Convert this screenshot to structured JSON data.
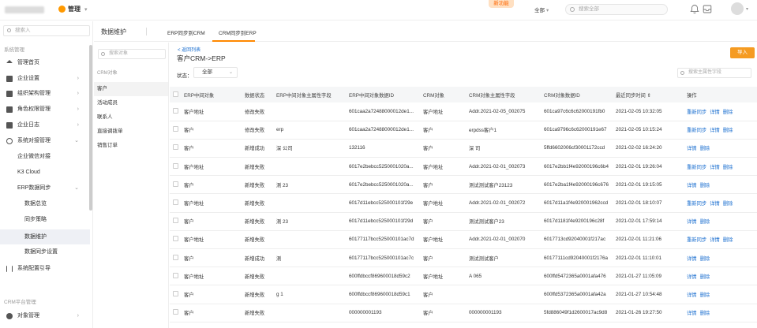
{
  "topbar": {
    "brand_label": "管理",
    "new_badge": "新功能",
    "scope_label": "全部",
    "search_placeholder": "搜索全部"
  },
  "sidebar": {
    "search_placeholder": "搜索入",
    "section1": "系统管理",
    "items": [
      {
        "label": "管理首页"
      },
      {
        "label": "企业设置"
      },
      {
        "label": "组织架构管理"
      },
      {
        "label": "角色权限管理"
      },
      {
        "label": "企业日志"
      },
      {
        "label": "系统对接管理"
      },
      {
        "label": "企业微信对接"
      },
      {
        "label": "K3 Cloud"
      },
      {
        "label": "ERP数据同步"
      },
      {
        "label": "数据总览"
      },
      {
        "label": "同步策略"
      },
      {
        "label": "数据维护"
      },
      {
        "label": "数据同步设置"
      },
      {
        "label": "系统配置引导"
      }
    ],
    "section2": "CRM平台管理",
    "bottom_item": "对象管理"
  },
  "tabs": {
    "title": "数据维护",
    "tab1": "ERP同步到CRM",
    "tab2": "CRM同步到ERP"
  },
  "objects": {
    "search_placeholder": "搜索对象",
    "section": "CRM对象",
    "items": [
      "客户",
      "活动成员",
      "联系人",
      "直接调拨单",
      "销售订单"
    ]
  },
  "content": {
    "back_link": "< 返回列表",
    "title": "客户CRM->ERP",
    "import_label": "导入",
    "status_label": "状态：",
    "status_value": "全部",
    "field_search_placeholder": "搜索主属性字段"
  },
  "table": {
    "headers": [
      "ERP中间对象",
      "数据状态",
      "ERP中间对象主属性字段",
      "ERP中间对象数据ID",
      "CRM对象",
      "CRM对象主属性字段",
      "CRM对象数据ID",
      "最近同步时间 ⇕",
      "操作"
    ],
    "rows": [
      {
        "erp_obj": "客户地址",
        "status": "修改失败",
        "erp_field": "",
        "erp_id": "601caa2a72488000012de1...",
        "crm_obj": "客户地址",
        "crm_field": "Addr.2021-02-05_002075",
        "crm_id": "601ca97c6c6c62000191fb0",
        "time": "2021-02-05 10:32:05",
        "ops": [
          "重新同步",
          "详情",
          "删除"
        ]
      },
      {
        "erp_obj": "客户",
        "status": "修改失败",
        "erp_field": "erp",
        "erp_id": "601caa2a72488000012de1...",
        "crm_obj": "客户",
        "crm_field": "erpdss客户1",
        "crm_id": "601ca9796c6c62000191e67",
        "time": "2021-02-05 10:15:24",
        "ops": [
          "重新同步",
          "详情",
          "删除"
        ]
      },
      {
        "erp_obj": "客户",
        "status": "新增成功",
        "erp_field": "深 公司",
        "erp_id": "132116",
        "crm_obj": "客户",
        "crm_field": "深 司",
        "crm_id": "5ffd6602006cf30001172ccd",
        "time": "2021-02-02 16:24:20",
        "ops": [
          "详情",
          "删除"
        ]
      },
      {
        "erp_obj": "客户地址",
        "status": "新增失败",
        "erp_field": "",
        "erp_id": "6017e2bebcc5250001020a...",
        "crm_obj": "客户地址",
        "crm_field": "Addr.2021-02-01_002073",
        "crm_id": "6017e2bb1f4e92000196c6b4",
        "time": "2021-02-01 19:26:04",
        "ops": [
          "重新同步",
          "详情",
          "删除"
        ]
      },
      {
        "erp_obj": "客户",
        "status": "新增失败",
        "erp_field": "测 23",
        "erp_id": "6017e2bebcc5250001020a...",
        "crm_obj": "客户",
        "crm_field": "测试测试客户23123",
        "crm_id": "6017e2ba1f4e92000196c676",
        "time": "2021-02-01 19:15:05",
        "ops": [
          "详情",
          "删除"
        ]
      },
      {
        "erp_obj": "客户地址",
        "status": "新增失败",
        "erp_field": "",
        "erp_id": "6017d11ebcc525000101f29e",
        "crm_obj": "客户地址",
        "crm_field": "Addr.2021-02-01_002072",
        "crm_id": "6017d11a1f4e920001962ccd",
        "time": "2021-02-01 18:10:07",
        "ops": [
          "重新同步",
          "详情",
          "删除"
        ]
      },
      {
        "erp_obj": "客户",
        "status": "新增失败",
        "erp_field": "测 23",
        "erp_id": "6017d11ebcc525000101f29d",
        "crm_obj": "客户",
        "crm_field": "测试测试客户23",
        "crm_id": "6017d1181f4e9200196c28f",
        "time": "2021-02-01 17:59:14",
        "ops": [
          "详情",
          "删除"
        ]
      },
      {
        "erp_obj": "客户地址",
        "status": "新增失败",
        "erp_field": "",
        "erp_id": "60177117bcc525000101ac7d",
        "crm_obj": "客户地址",
        "crm_field": "Addr.2021-02-01_002070",
        "crm_id": "6017713cd92040001f217ac",
        "time": "2021-02-01 11:21:06",
        "ops": [
          "重新同步",
          "详情",
          "删除"
        ]
      },
      {
        "erp_obj": "客户",
        "status": "新增成功",
        "erp_field": "测",
        "erp_id": "60177117bcc525000101ac7c",
        "crm_obj": "客户",
        "crm_field": "测试测试客户",
        "crm_id": "60177111cd92040001f2176a",
        "time": "2021-02-01 11:10:01",
        "ops": [
          "详情",
          "删除"
        ]
      },
      {
        "erp_obj": "客户地址",
        "status": "新增失败",
        "erp_field": "",
        "erp_id": "600ffdbccf869600018d59c2",
        "crm_obj": "客户地址",
        "crm_field": "A 065",
        "crm_id": "600ffd5472365a0001afa476",
        "time": "2021-01-27 11:05:09",
        "ops": [
          "详情",
          "删除"
        ]
      },
      {
        "erp_obj": "客户",
        "status": "新增失败",
        "erp_field": "g 1",
        "erp_id": "600ffdbccf869600018d59c1",
        "crm_obj": "客户",
        "crm_field": "",
        "crm_id": "600ffd5372365a0001afa42a",
        "time": "2021-01-27 10:54:48",
        "ops": [
          "详情",
          "删除"
        ]
      },
      {
        "erp_obj": "客户",
        "status": "新增失败",
        "erp_field": "",
        "erp_id": "000000001193",
        "crm_obj": "客户",
        "crm_field": "000000001193",
        "crm_id": "5fd886049f1d2600017ac9d8",
        "time": "2021-01-26 19:27:50",
        "ops": [
          "详情",
          "删除"
        ]
      }
    ]
  }
}
